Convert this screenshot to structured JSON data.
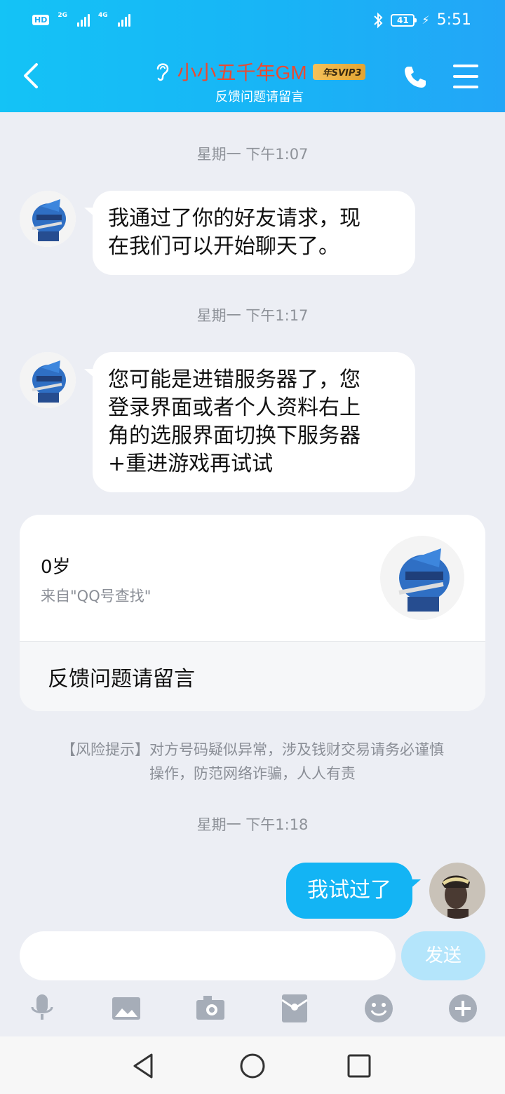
{
  "status_bar": {
    "hd": "HD",
    "hd_sub": "2",
    "net1": "2G",
    "net2": "4G",
    "battery": "41",
    "time": "5:51"
  },
  "header": {
    "title": "小小五千年GM",
    "vip_badge": "年SVIP3",
    "subtitle": "反馈问题请留言"
  },
  "messages": [
    {
      "timestamp": "星期一 下午1:07",
      "text_lines": [
        "我通过了你的好友请求，现",
        "在我们可以开始聊天了。"
      ]
    },
    {
      "timestamp": "星期一 下午1:17",
      "text_lines": [
        "您可能是进错服务器了，您",
        "登录界面或者个人资料右上",
        "角的选服界面切换下服务器",
        "+重进游戏再试试"
      ]
    }
  ],
  "profile_card": {
    "age": "0岁",
    "source": "来自\"QQ号查找\"",
    "signature": "反馈问题请留言"
  },
  "risk_warning": {
    "line1": "【风险提示】对方号码疑似异常，涉及钱财交易请务必谨慎",
    "line2": "操作，防范网络诈骗，人人有责"
  },
  "outgoing": {
    "timestamp": "星期一 下午1:18",
    "text": "我试过了"
  },
  "composer": {
    "placeholder": "",
    "send_label": "发送"
  },
  "toolbar_icons": [
    "microphone-icon",
    "image-icon",
    "camera-icon",
    "red-packet-icon",
    "emoji-icon",
    "plus-icon"
  ],
  "colors": {
    "header_start": "#14c3f6",
    "header_end": "#23a6f7",
    "title": "#e94a32",
    "outgoing_bubble": "#13b4f4",
    "send_disabled": "#b4e5fb"
  }
}
